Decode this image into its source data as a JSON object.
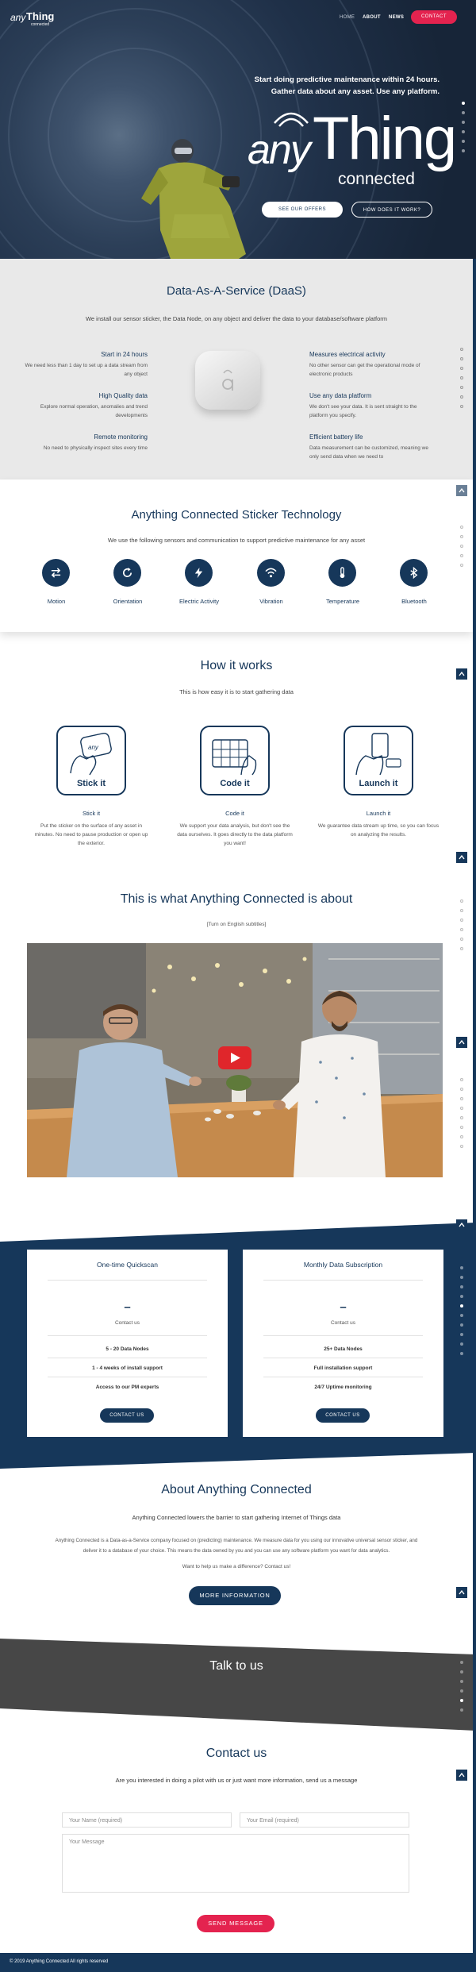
{
  "colors": {
    "navy": "#16375a",
    "accent": "#e4234f",
    "gray_bg": "#e9e9e9",
    "dark_band": "#474747"
  },
  "header": {
    "logo": {
      "any": "any",
      "thing": "Thing",
      "sub": "connected"
    },
    "nav": [
      {
        "label": "HOME"
      },
      {
        "label": "ABOUT"
      },
      {
        "label": "NEWS"
      }
    ],
    "contact_label": "CONTACT"
  },
  "hero": {
    "tagline_1": "Start doing predictive maintenance within 24 hours.",
    "tagline_2": "Gather data about any asset. Use any platform.",
    "logo": {
      "any": "any",
      "thing": "Thing",
      "sub": "connected"
    },
    "btn_offers": "SEE OUR OFFERS",
    "btn_how": "HOW DOES IT WORK?"
  },
  "daas": {
    "title": "Data-As-A-Service (DaaS)",
    "subtitle": "We install our sensor sticker, the Data Node, on any object and deliver the data to your database/software platform",
    "left": [
      {
        "title": "Start in 24 hours",
        "text": [
          "We need less than 1 day to set up a data stream from",
          "any object"
        ]
      },
      {
        "title": "High Quality data",
        "text": [
          "Explore normal operation, anomalies and trend",
          "developments"
        ]
      },
      {
        "title": "Remote monitoring",
        "text": [
          "No need to physically inspect sites every time"
        ]
      }
    ],
    "right": [
      {
        "title": "Measures electrical activity",
        "text": [
          "No other sensor can get the operational mode of",
          "electronic products"
        ]
      },
      {
        "title": "Use any data platform",
        "text": [
          "We don't see your data. It is sent straight to the",
          "platform you specify."
        ]
      },
      {
        "title": "Efficient battery life",
        "text": [
          "Data measurement can be customized, meaning we",
          "only send data when we need to"
        ]
      }
    ]
  },
  "sticker": {
    "title": "Anything Connected Sticker Technology",
    "subtitle": "We use the following sensors and communication to support predictive maintenance for any asset",
    "items": [
      {
        "label": "Motion",
        "icon": "arrows-icon"
      },
      {
        "label": "Orientation",
        "icon": "rotate-icon"
      },
      {
        "label": "Electric Activity",
        "icon": "bolt-icon"
      },
      {
        "label": "Vibration",
        "icon": "wifi-icon"
      },
      {
        "label": "Temperature",
        "icon": "thermometer-icon"
      },
      {
        "label": "Bluetooth",
        "icon": "bluetooth-icon"
      }
    ]
  },
  "how": {
    "title": "How it works",
    "subtitle": "This is how easy it is to start gathering data",
    "steps": [
      {
        "box": "Stick it",
        "title": "Stick it",
        "text": [
          "Put the sticker on the surface of any asset in",
          "minutes. No need to pause production or open up",
          "the exterior."
        ]
      },
      {
        "box": "Code it",
        "title": "Code it",
        "text": [
          "We support your data analysis, but don't see the",
          "data ourselves. It goes directly to the data platform",
          "you want!"
        ]
      },
      {
        "box": "Launch it",
        "title": "Launch it",
        "text": [
          "We guarantee data stream up time, so you can focus",
          "on analyzing the results."
        ]
      }
    ]
  },
  "video": {
    "title": "This is what Anything Connected is about",
    "note": "[Turn on English subtitles]"
  },
  "pricing": {
    "cards": [
      {
        "title": "One-time Quickscan",
        "price": "–",
        "price_sub": "Contact us",
        "features": [
          "5 - 20 Data Nodes",
          "1 - 4 weeks of install support",
          "Access to our PM experts"
        ],
        "button": "CONTACT US"
      },
      {
        "title": "Monthly Data Subscription",
        "price": "–",
        "price_sub": "Contact us",
        "features": [
          "25+ Data Nodes",
          "Full installation support",
          "24/7 Uptime monitoring"
        ],
        "button": "CONTACT US"
      }
    ]
  },
  "about": {
    "title": "About Anything Connected",
    "subtitle": "Anything Connected lowers the barrier to start gathering Internet of Things data",
    "text_1": "Anything Connected is a Data-as-a-Service company focused on (predicting) maintenance. We measure data for you using our innovative universal sensor sticker, and",
    "text_2": "deliver it to a database of your choice. This means the data owned by you and you can use any software platform you want for data analytics.",
    "text_3": "Want to help us make a difference? Contact us!",
    "button": "MORE INFORMATION"
  },
  "talk": {
    "title": "Talk to us"
  },
  "contact": {
    "title": "Contact us",
    "subtitle": "Are you interested in doing a pilot with us or just want more information, send us a message",
    "name_ph": "Your Name (required)",
    "email_ph": "Your Email (required)",
    "message_ph": "Your Message",
    "button": "SEND MESSAGE"
  },
  "footer": {
    "text": "© 2019 Anything Connected All rights reserved"
  }
}
